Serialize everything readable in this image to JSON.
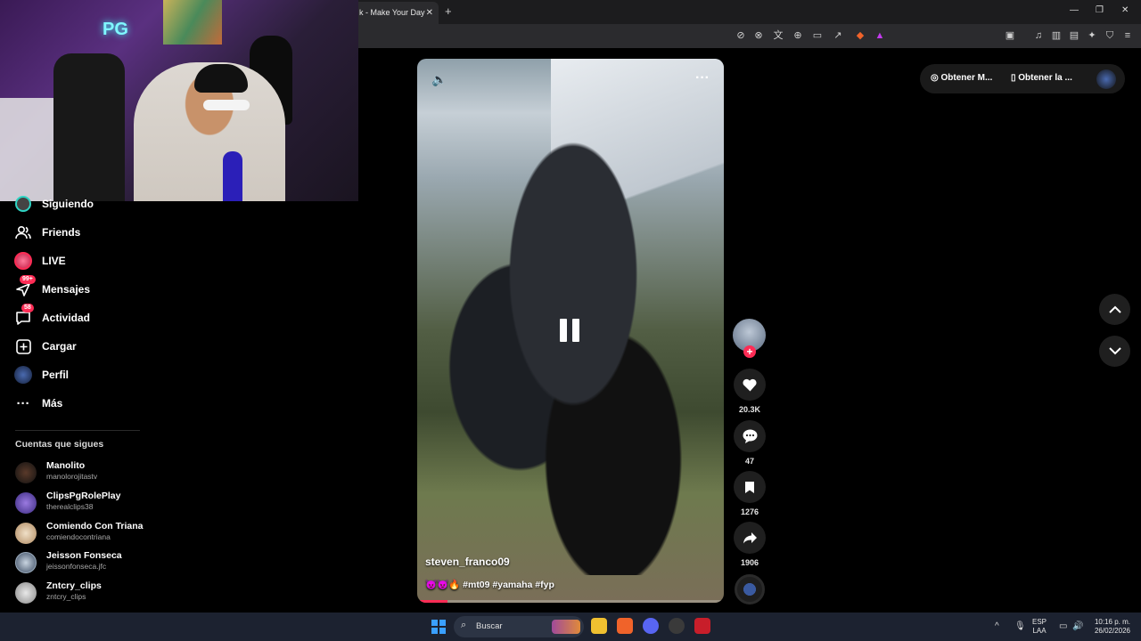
{
  "browser": {
    "tab_title": "k - Make Your Day",
    "tab_close": "✕",
    "new_tab": "+",
    "win_minimize": "—",
    "win_restore": "❐",
    "win_close": "✕"
  },
  "sidebar": {
    "items": [
      {
        "label": "Siguiendo",
        "icon": "following-avatar-icon"
      },
      {
        "label": "Friends",
        "icon": "friends-icon"
      },
      {
        "label": "LIVE",
        "icon": "live-icon"
      },
      {
        "label": "Mensajes",
        "icon": "messages-icon",
        "badge": "99+"
      },
      {
        "label": "Actividad",
        "icon": "activity-icon",
        "badge": "58"
      },
      {
        "label": "Cargar",
        "icon": "upload-icon"
      },
      {
        "label": "Perfil",
        "icon": "profile-icon"
      },
      {
        "label": "Más",
        "icon": "more-icon"
      }
    ],
    "section_title": "Cuentas que sigues",
    "following": [
      {
        "name": "Manolito",
        "handle": "manolorojitastv"
      },
      {
        "name": "ClipsPgRolePlay",
        "handle": "therealclips38"
      },
      {
        "name": "Comiendo Con Triana",
        "handle": "comiendocontriana"
      },
      {
        "name": "Jeisson Fonseca",
        "handle": "jeissonfonseca.jfc"
      },
      {
        "name": "Zntcry_clips",
        "handle": "zntcry_clips"
      }
    ]
  },
  "webcam": {
    "sign": "PG"
  },
  "video": {
    "author": "steven_franco09",
    "caption": "😈😈🔥 #mt09 #yamaha #fyp",
    "progress": 0.1
  },
  "actions": {
    "likes": "20.3K",
    "comments": "47",
    "saves": "1276",
    "shares": "1906"
  },
  "topright": {
    "item1": "Obtener M...",
    "item2": "Obtener la ..."
  },
  "taskbar": {
    "search_placeholder": "Buscar",
    "lang_top": "ESP",
    "lang_bottom": "LAA",
    "time": "10:16 p. m.",
    "date": "26/02/2026"
  },
  "colors": {
    "accent": "#fe2c55",
    "background": "#000000",
    "taskbar": "#1c2230"
  }
}
